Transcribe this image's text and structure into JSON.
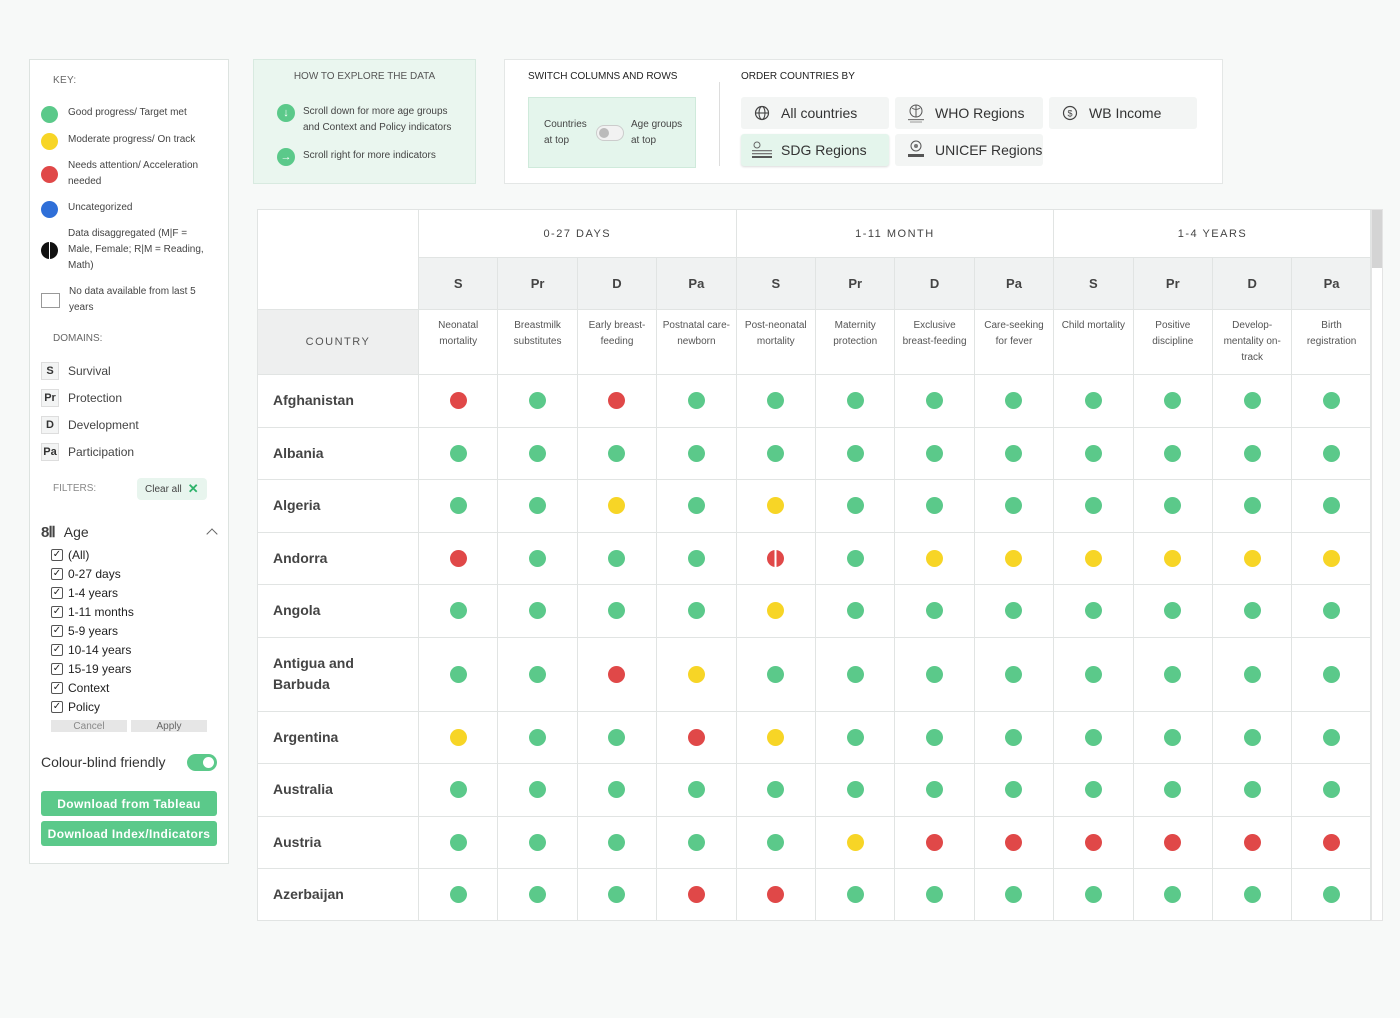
{
  "key": {
    "title": "KEY:",
    "items": [
      {
        "label": "Good progress/ Target met",
        "swatch": "green",
        "color": "#5bc98a"
      },
      {
        "label": "Moderate progress/ On track",
        "swatch": "yellow",
        "color": "#f7d526"
      },
      {
        "label": "Needs attention/ Acceleration needed",
        "swatch": "red",
        "color": "#e04848"
      },
      {
        "label": "Uncategorized",
        "swatch": "blue",
        "color": "#2f6fd8"
      },
      {
        "label": "Data disaggregated (M|F = Male, Female; R|M = Reading, Math)",
        "swatch": "half",
        "color": "#111111"
      },
      {
        "label": "No data available from last 5 years",
        "swatch": "empty",
        "color": "#ffffff"
      }
    ]
  },
  "domains": {
    "title": "DOMAINS:",
    "items": [
      {
        "code": "S",
        "label": "Survival"
      },
      {
        "code": "Pr",
        "label": "Protection"
      },
      {
        "code": "D",
        "label": "Development"
      },
      {
        "code": "Pa",
        "label": "Participation"
      }
    ]
  },
  "filters": {
    "title": "FILTERS:",
    "clear_label": "Clear all",
    "age_label": "Age",
    "age_options": [
      "(All)",
      "0-27 days",
      "1-4 years",
      "1-11 months",
      "5-9 years",
      "10-14 years",
      "15-19 years",
      "Context",
      "Policy"
    ],
    "cancel_label": "Cancel",
    "apply_label": "Apply"
  },
  "colour_blind": {
    "label": "Colour-blind friendly",
    "enabled": true
  },
  "downloads": {
    "tableau_label": "Download from Tableau",
    "index_label": "Download Index/Indicators"
  },
  "howto": {
    "title": "HOW TO EXPLORE THE DATA",
    "rows": [
      {
        "icon": "arrow-down-icon",
        "text": "Scroll down for more age groups and Context and Policy indicators"
      },
      {
        "icon": "arrow-right-icon",
        "text": "Scroll right for more indicators"
      }
    ]
  },
  "switch": {
    "title": "SWITCH COLUMNS AND ROWS",
    "left_label": "Countries at top",
    "right_label": "Age groups at top"
  },
  "order": {
    "title": "ORDER COUNTRIES BY",
    "buttons": [
      {
        "label": "All countries",
        "icon": "globe-icon",
        "active": false
      },
      {
        "label": "WHO Regions",
        "icon": "who-logo-icon",
        "active": false
      },
      {
        "label": "WB Income",
        "icon": "dollar-coin-icon",
        "active": false
      },
      {
        "label": "SDG Regions",
        "icon": "sdg-logo-icon",
        "active": true
      },
      {
        "label": "UNICEF Regions",
        "icon": "unicef-logo-icon",
        "active": false
      }
    ]
  },
  "table": {
    "country_header": "COUNTRY",
    "groups": [
      "0-27 DAYS",
      "1-11 MONTH",
      "1-4 YEARS"
    ],
    "domain_codes": [
      "S",
      "Pr",
      "D",
      "Pa",
      "S",
      "Pr",
      "D",
      "Pa",
      "S",
      "Pr",
      "D",
      "Pa"
    ],
    "indicators": [
      "Neonatal mortality",
      "Breastmilk substitutes",
      "Early breast-feeding",
      "Postnatal care-newborn",
      "Post-neonatal mortality",
      "Maternity protection",
      "Exclusive breast-feeding",
      "Care-seeking for fever",
      "Child mortality",
      "Positive discipline",
      "Develop-mentality on-track",
      "Birth registration"
    ],
    "status_legend": {
      "g": "Good progress/ Target met",
      "y": "Moderate progress/ On track",
      "r": "Needs attention/ Acceleration needed",
      "s": "Data disaggregated"
    },
    "rows": [
      {
        "country": "Afghanistan",
        "status": [
          "r",
          "g",
          "r",
          "g",
          "g",
          "g",
          "g",
          "g",
          "g",
          "g",
          "g",
          "g"
        ]
      },
      {
        "country": "Albania",
        "status": [
          "g",
          "g",
          "g",
          "g",
          "g",
          "g",
          "g",
          "g",
          "g",
          "g",
          "g",
          "g"
        ]
      },
      {
        "country": "Algeria",
        "status": [
          "g",
          "g",
          "y",
          "g",
          "y",
          "g",
          "g",
          "g",
          "g",
          "g",
          "g",
          "g"
        ]
      },
      {
        "country": "Andorra",
        "status": [
          "r",
          "g",
          "g",
          "g",
          "s",
          "g",
          "y",
          "y",
          "y",
          "y",
          "y",
          "y"
        ]
      },
      {
        "country": "Angola",
        "status": [
          "g",
          "g",
          "g",
          "g",
          "y",
          "g",
          "g",
          "g",
          "g",
          "g",
          "g",
          "g"
        ]
      },
      {
        "country": "Antigua and Barbuda",
        "status": [
          "g",
          "g",
          "r",
          "y",
          "g",
          "g",
          "g",
          "g",
          "g",
          "g",
          "g",
          "g"
        ]
      },
      {
        "country": "Argentina",
        "status": [
          "y",
          "g",
          "g",
          "r",
          "y",
          "g",
          "g",
          "g",
          "g",
          "g",
          "g",
          "g"
        ]
      },
      {
        "country": "Australia",
        "status": [
          "g",
          "g",
          "g",
          "g",
          "g",
          "g",
          "g",
          "g",
          "g",
          "g",
          "g",
          "g"
        ]
      },
      {
        "country": "Austria",
        "status": [
          "g",
          "g",
          "g",
          "g",
          "g",
          "y",
          "r",
          "r",
          "r",
          "r",
          "r",
          "r"
        ]
      },
      {
        "country": "Azerbaijan",
        "status": [
          "g",
          "g",
          "g",
          "r",
          "r",
          "g",
          "g",
          "g",
          "g",
          "g",
          "g",
          "g"
        ]
      }
    ]
  }
}
